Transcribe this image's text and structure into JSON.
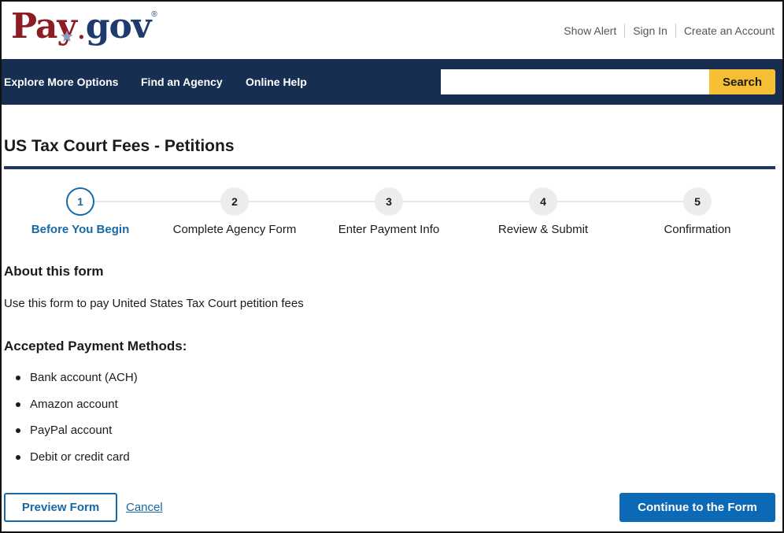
{
  "header": {
    "logo": {
      "pay": "Pay",
      "dot": ".",
      "gov": "gov",
      "reg": "®"
    },
    "links": [
      "Show Alert",
      "Sign In",
      "Create an Account"
    ]
  },
  "nav": {
    "items": [
      "Explore More Options",
      "Find an Agency",
      "Online Help"
    ],
    "search": {
      "value": "",
      "placeholder": "",
      "button_label": "Search"
    }
  },
  "page": {
    "title": "US Tax Court Fees - Petitions"
  },
  "steps": [
    {
      "number": "1",
      "label": "Before You Begin",
      "active": true
    },
    {
      "number": "2",
      "label": "Complete Agency Form",
      "active": false
    },
    {
      "number": "3",
      "label": "Enter Payment Info",
      "active": false
    },
    {
      "number": "4",
      "label": "Review & Submit",
      "active": false
    },
    {
      "number": "5",
      "label": "Confirmation",
      "active": false
    }
  ],
  "about": {
    "heading": "About this form",
    "description": "Use this form to pay United States Tax Court petition fees"
  },
  "payment_methods": {
    "heading": "Accepted Payment Methods:",
    "items": [
      "Bank account (ACH)",
      "Amazon account",
      "PayPal account",
      "Debit or credit card"
    ]
  },
  "actions": {
    "preview_label": "Preview Form",
    "cancel_label": "Cancel",
    "continue_label": "Continue to the Form"
  },
  "colors": {
    "navbar": "#162e51",
    "search_button": "#f6bf33",
    "primary_blue": "#0b69b6",
    "title_rule": "#1f3a5f"
  },
  "icons": {
    "logo_star": "star-icon",
    "bullet": "bullet-icon"
  }
}
